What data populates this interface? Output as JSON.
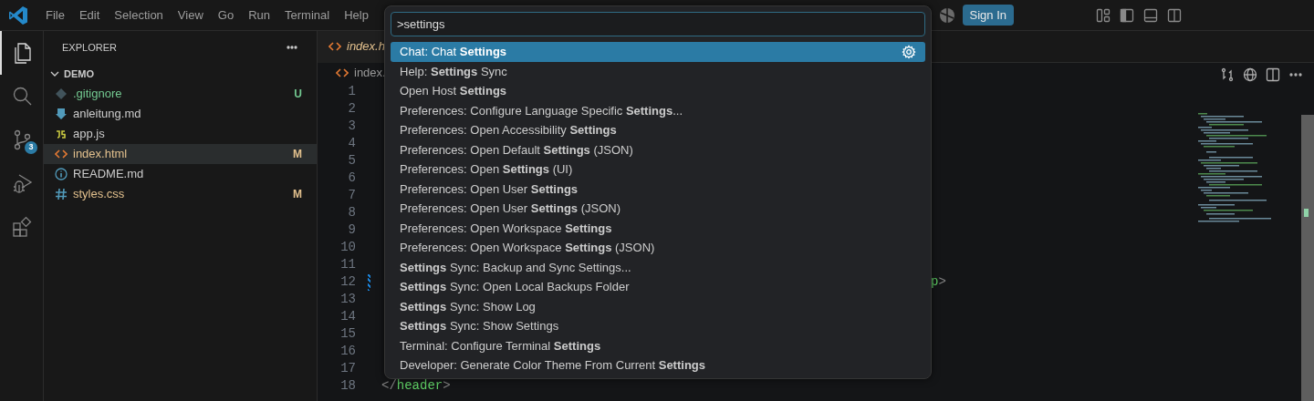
{
  "title_bar": {
    "menus": [
      "File",
      "Edit",
      "Selection",
      "View",
      "Go",
      "Run",
      "Terminal",
      "Help"
    ],
    "sign_in": "Sign In"
  },
  "activity_bar": [
    {
      "kind": "explorer",
      "selected": true
    },
    {
      "kind": "search",
      "selected": false
    },
    {
      "kind": "source_control",
      "selected": false,
      "badge": "3"
    },
    {
      "kind": "run_debug",
      "selected": false
    },
    {
      "kind": "extensions",
      "selected": false
    }
  ],
  "explorer": {
    "title": "EXPLORER",
    "folder": {
      "name": "DEMO",
      "expanded": true
    },
    "files": [
      {
        "name": ".gitignore",
        "kind": "git",
        "status": "U",
        "selected": false
      },
      {
        "name": "anleitung.md",
        "kind": "markdown",
        "selected": false
      },
      {
        "name": "app.js",
        "kind": "js",
        "selected": false
      },
      {
        "name": "index.html",
        "kind": "html",
        "status": "M",
        "selected": true
      },
      {
        "name": "README.md",
        "kind": "info",
        "selected": false
      },
      {
        "name": "styles.css",
        "kind": "css",
        "status": "M",
        "selected": false
      }
    ]
  },
  "editor": {
    "tab": "index.h",
    "breadcrumb": "index.",
    "lines": [
      {
        "number": "1"
      },
      {
        "number": "2"
      },
      {
        "number": "3"
      },
      {
        "number": "4"
      },
      {
        "number": "5"
      },
      {
        "number": "6"
      },
      {
        "number": "7"
      },
      {
        "number": "8"
      },
      {
        "number": "9"
      },
      {
        "number": "10"
      },
      {
        "number": "11"
      },
      {
        "number": "12",
        "changed": true,
        "tail": [
          {
            "text": "p",
            "kind": "tag"
          },
          {
            "text": ">",
            "kind": "punct"
          }
        ]
      },
      {
        "number": "13"
      },
      {
        "number": "14"
      },
      {
        "number": "15"
      },
      {
        "number": "16"
      },
      {
        "number": "17"
      },
      {
        "number": "18",
        "code": [
          {
            "text": "</",
            "kind": "punct"
          },
          {
            "text": "header",
            "kind": "tag"
          },
          {
            "text": ">",
            "kind": "punct"
          }
        ]
      }
    ]
  },
  "command_palette": {
    "input": ">settings",
    "items": [
      {
        "label": "Chat: Chat **Settings**",
        "selected": true
      },
      {
        "label": "Help: **Settings** Sync",
        "selected": false
      },
      {
        "label": "Open Host **Settings**",
        "selected": false
      },
      {
        "label": "Preferences: Configure Language Specific **Settings**...",
        "selected": false
      },
      {
        "label": "Preferences: Open Accessibility **Settings**",
        "selected": false
      },
      {
        "label": "Preferences: Open Default **Settings** (JSON)",
        "selected": false
      },
      {
        "label": "Preferences: Open **Settings** (UI)",
        "selected": false
      },
      {
        "label": "Preferences: Open User **Settings**",
        "selected": false
      },
      {
        "label": "Preferences: Open User **Settings** (JSON)",
        "selected": false
      },
      {
        "label": "Preferences: Open Workspace **Settings**",
        "selected": false
      },
      {
        "label": "Preferences: Open Workspace **Settings** (JSON)",
        "selected": false
      },
      {
        "label": "**Settings** Sync: Backup and Sync Settings...",
        "selected": false
      },
      {
        "label": "**Settings** Sync: Open Local Backups Folder",
        "selected": false
      },
      {
        "label": "**Settings** Sync: Show Log",
        "selected": false
      },
      {
        "label": "**Settings** Sync: Show Settings",
        "selected": false
      },
      {
        "label": "Terminal: Configure Terminal **Settings**",
        "selected": false
      },
      {
        "label": "Developer: Generate Color Theme From Current **Settings**",
        "selected": false
      }
    ]
  }
}
